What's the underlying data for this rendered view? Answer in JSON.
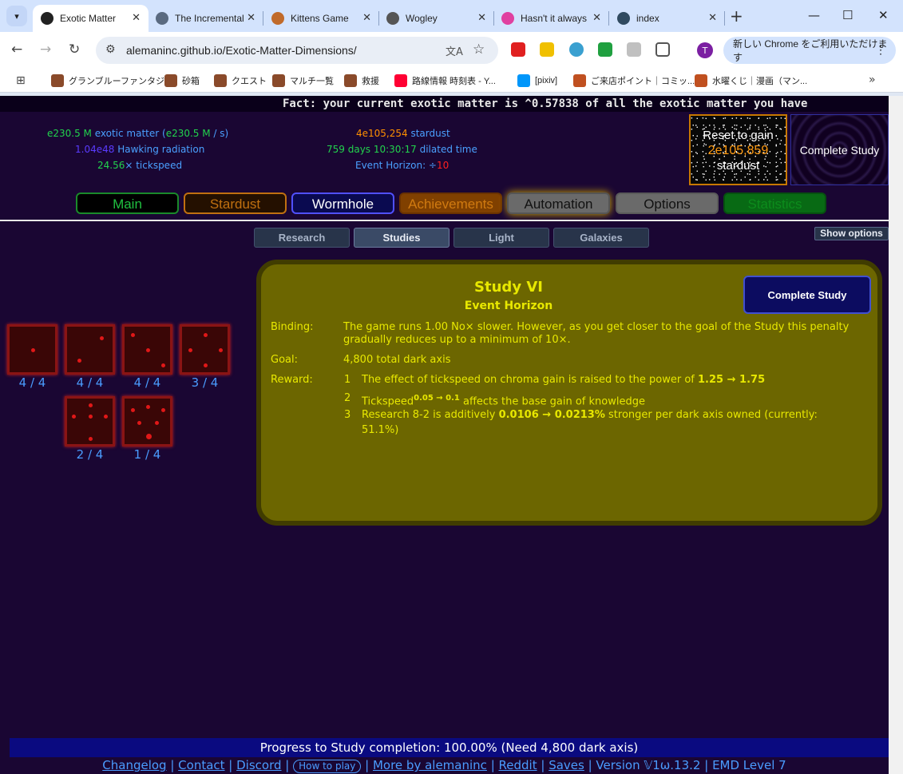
{
  "browser": {
    "tabs": [
      {
        "title": "Exotic Matter",
        "active": true,
        "fav_color": "#222222"
      },
      {
        "title": "The Incremental",
        "active": false,
        "fav_color": "#5a6a80"
      },
      {
        "title": "Kittens Game",
        "active": false,
        "fav_color": "#c06a2a"
      },
      {
        "title": "Wogley",
        "active": false,
        "fav_color": "#555555"
      },
      {
        "title": "Hasn't it always",
        "active": false,
        "fav_color": "#e040a0"
      },
      {
        "title": "index",
        "active": false,
        "fav_color": "#304a60"
      }
    ],
    "url": "alemaninc.github.io/Exotic-Matter-Dimensions/",
    "profile_initial": "T",
    "update_text": "新しい Chrome をご利用いただけます",
    "bookmarks": [
      {
        "label": "グランブルーファンタジー",
        "color": "#8a4a2a"
      },
      {
        "label": "砂箱",
        "color": "#8a4a2a"
      },
      {
        "label": "クエスト",
        "color": "#8a4a2a"
      },
      {
        "label": "マルチ一覧",
        "color": "#8a4a2a"
      },
      {
        "label": "救援",
        "color": "#8a4a2a"
      },
      {
        "label": "路線情報 時刻表 - Y...",
        "color": "#ff0033"
      },
      {
        "label": "[pixiv]",
        "color": "#0096fa"
      },
      {
        "label": "ご来店ポイント｜コミッ...",
        "color": "#c05020"
      },
      {
        "label": "水曜くじ｜漫画（マン...",
        "color": "#c05020"
      }
    ]
  },
  "ticker": "Fact: your current exotic matter is ^0.57838 of all the exotic matter you have",
  "resources": {
    "exotic_matter_value": "e230.5 M",
    "exotic_matter_label": "exotic matter (",
    "exotic_matter_rate": "e230.5 M",
    "exotic_matter_rate_suffix": " / s)",
    "hawking_value": "1.04e48",
    "hawking_label": "Hawking radiation",
    "tickspeed_value": "24.56",
    "tickspeed_label": "× tickspeed",
    "stardust_value": "4e105,254",
    "stardust_label": "stardust",
    "dilated_value": "759 days 10:30:17",
    "dilated_label": "dilated time",
    "event_horizon_label": "Event Horizon: ÷",
    "event_horizon_value": "10"
  },
  "reset": {
    "line1": "Reset to gain",
    "gain": "2e105,859",
    "line3": "stardust"
  },
  "complete_top": "Complete Study",
  "nav_tabs": [
    "Main",
    "Stardust",
    "Wormhole",
    "Achievements",
    "Automation",
    "Options",
    "Statistics"
  ],
  "subtabs": [
    "Research",
    "Studies",
    "Light",
    "Galaxies"
  ],
  "show_options": "Show options",
  "dice": [
    {
      "progress": "4 / 4",
      "pips": 1
    },
    {
      "progress": "4 / 4",
      "pips": 2
    },
    {
      "progress": "4 / 4",
      "pips": 3
    },
    {
      "progress": "3 / 4",
      "pips": 4
    },
    {
      "progress": "2 / 4",
      "pips": 5
    },
    {
      "progress": "1 / 4",
      "pips": 6
    }
  ],
  "study": {
    "title": "Study VI",
    "subtitle": "Event Horizon",
    "complete_button": "Complete Study",
    "binding_label": "Binding:",
    "binding_text": "The game runs 1.00 No× slower. However, as you get closer to the goal of the Study this penalty gradually reduces up to a minimum of 10×.",
    "goal_label": "Goal:",
    "goal_text": "4,800 total dark axis",
    "reward_label": "Reward:",
    "rewards": [
      {
        "num": "1",
        "pre": "The effect of tickspeed on chroma gain is raised to the power of ",
        "bold": "1.25 → 1.75",
        "post": ""
      },
      {
        "num": "2",
        "pre": "Tickspeed",
        "sup": "0.05 → 0.1",
        "post": " affects the base gain of knowledge"
      },
      {
        "num": "3",
        "pre": "Research 8-2 is additively ",
        "bold": "0.0106 → 0.0213%",
        "post": " stronger per dark axis owned (currently: 51.1%)"
      }
    ]
  },
  "progress": {
    "text": "Progress to Study completion: 100.00% (Need 4,800 dark axis)",
    "percent": 100
  },
  "footer": {
    "links": [
      "Changelog",
      "Contact",
      "Discord",
      "How to play",
      "More by alemaninc",
      "Reddit",
      "Saves"
    ],
    "version": "Version 𝕍1ω.13.2",
    "level": "EMD Level 7"
  }
}
